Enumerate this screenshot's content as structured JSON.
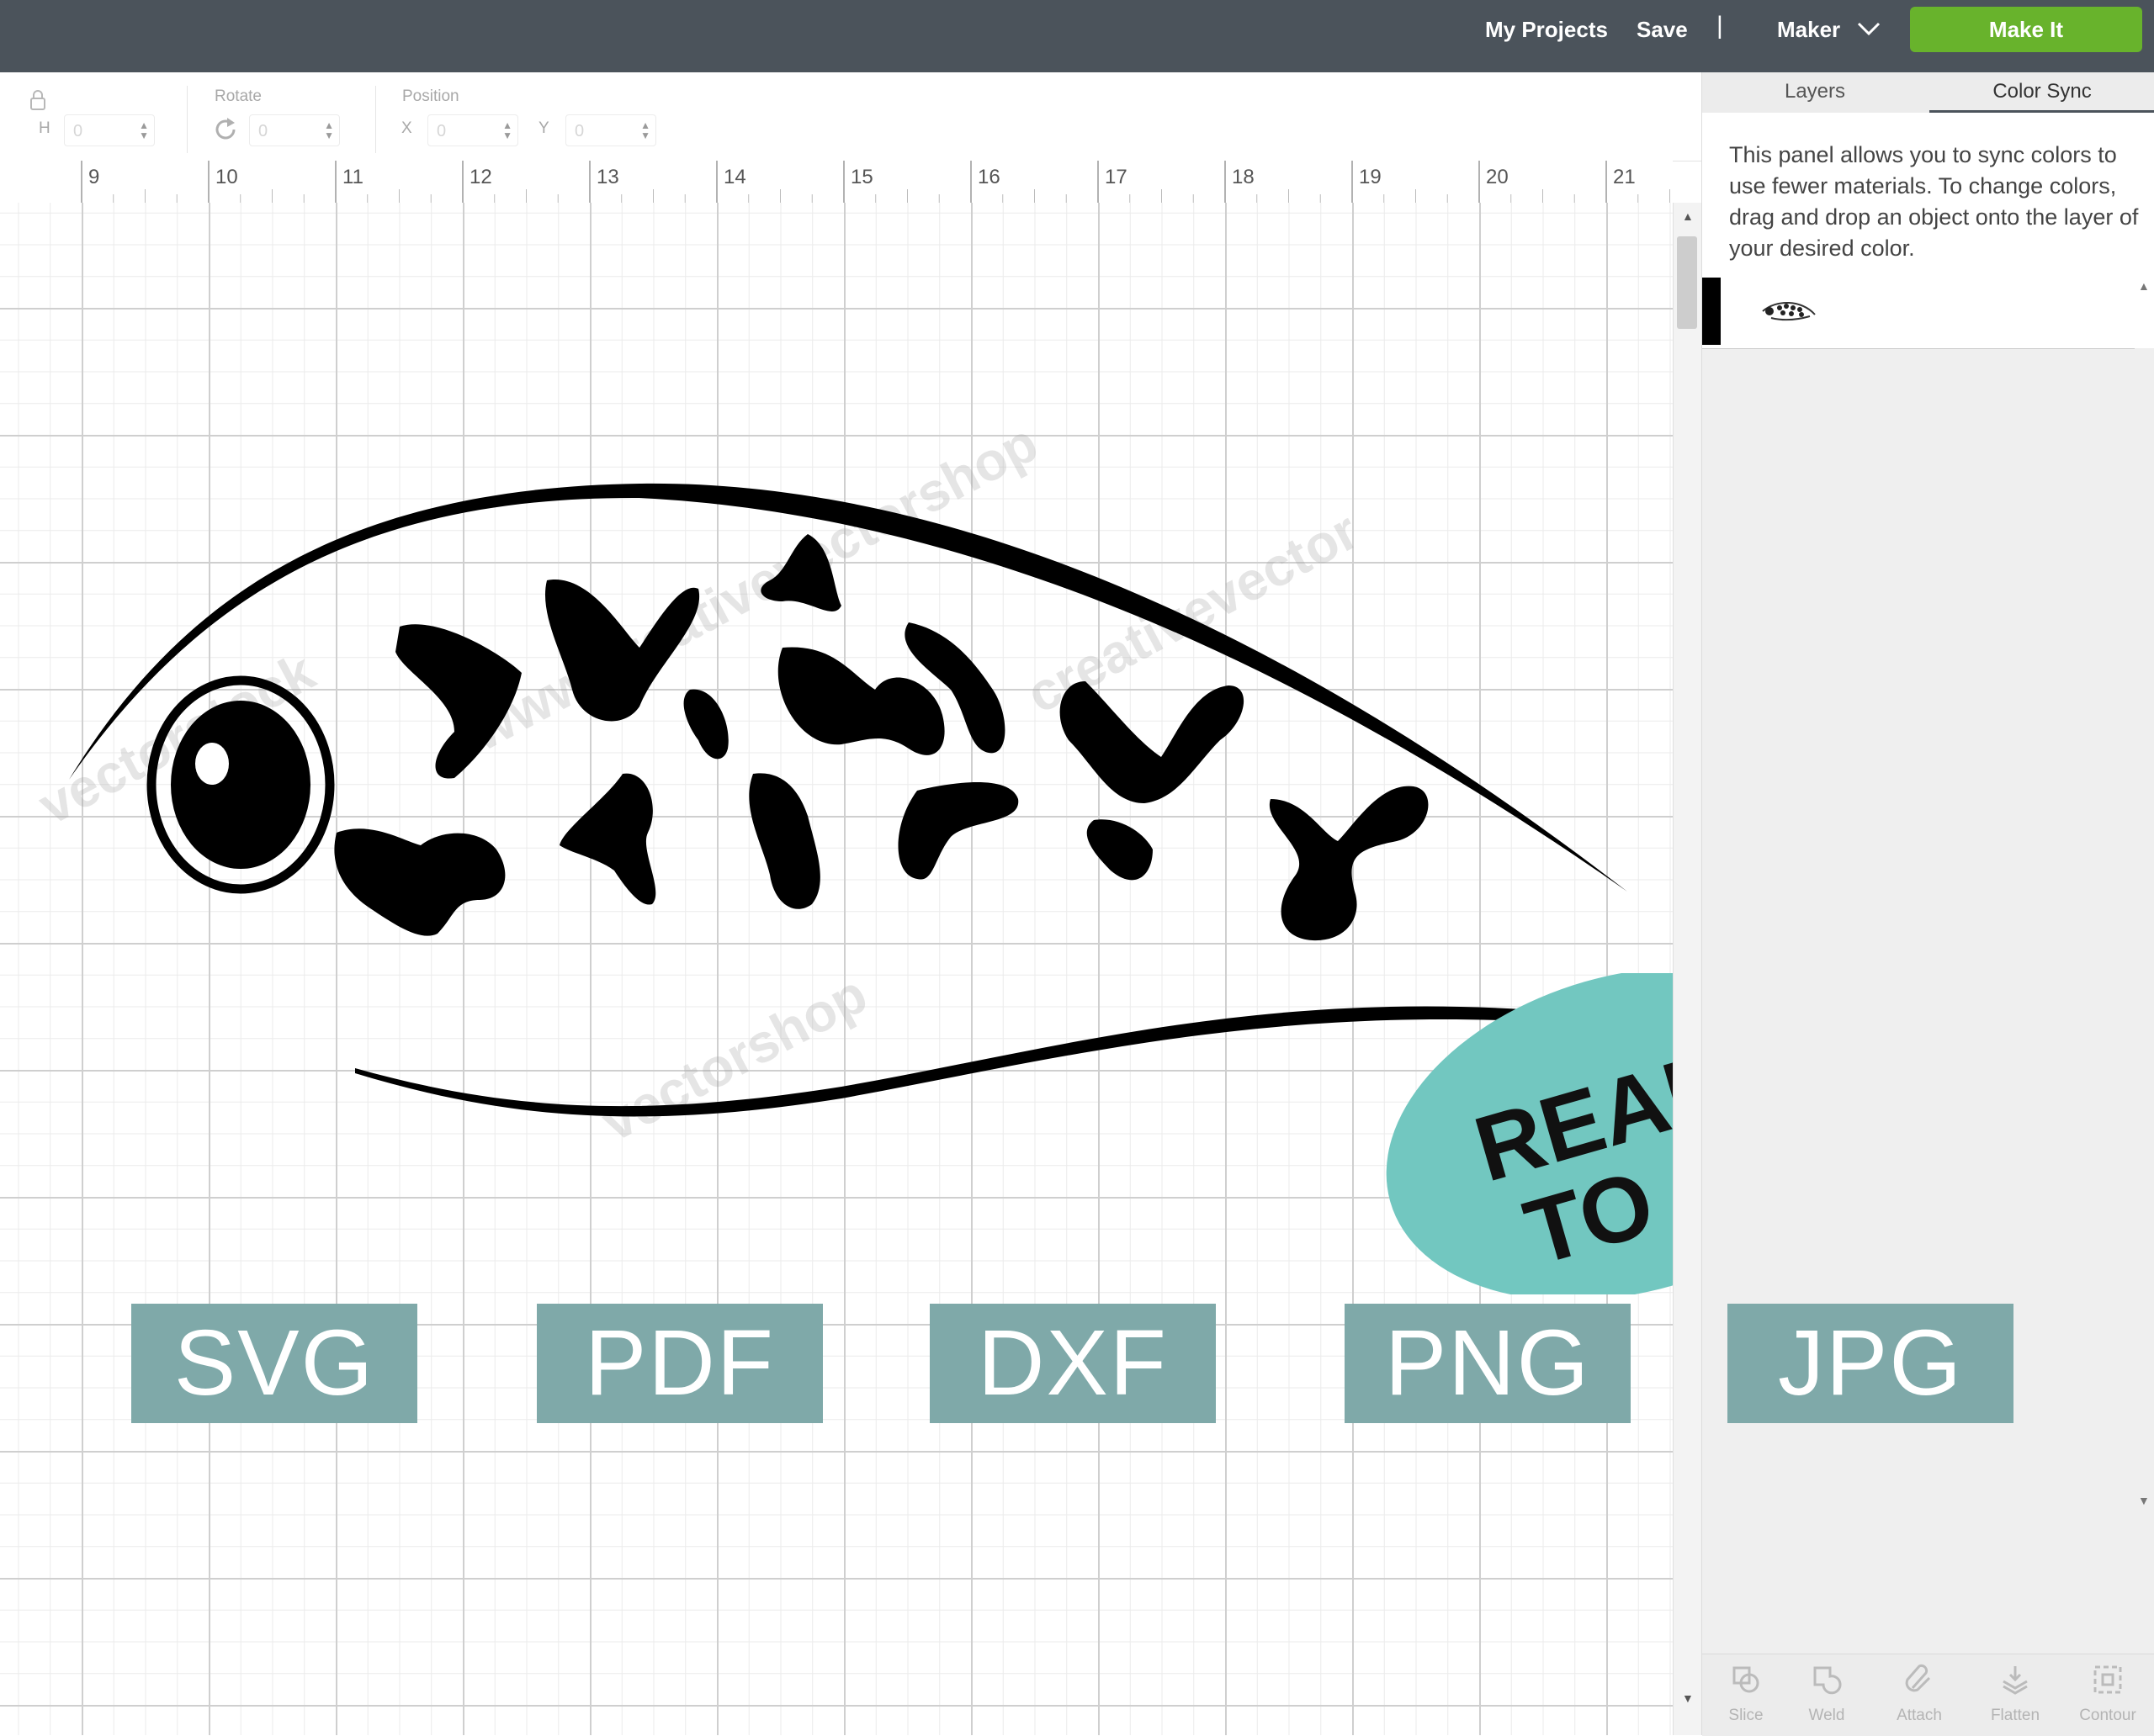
{
  "topbar": {
    "my_projects": "My Projects",
    "save": "Save",
    "divider": "|",
    "maker": "Maker",
    "make_it": "Make It",
    "icons": [
      "chevron-down-icon"
    ]
  },
  "toolbar": {
    "size_h_label": "H",
    "size_h_value": "0",
    "rotate_label": "Rotate",
    "rotate_value": "0",
    "position_label": "Position",
    "x_label": "X",
    "x_value": "0",
    "y_label": "Y",
    "y_value": "0",
    "icons": [
      "lock-icon",
      "rotate-icon"
    ]
  },
  "ruler": {
    "ticks": [
      "9",
      "10",
      "11",
      "12",
      "13",
      "14",
      "15",
      "16",
      "17",
      "18",
      "19",
      "20",
      "21"
    ]
  },
  "badge": {
    "line1": "READY",
    "line2": "TO CUT",
    "color": "#72c7c0"
  },
  "formats": [
    "SVG",
    "PDF",
    "DXF",
    "PNG",
    "JPG"
  ],
  "format_color": "#7fa9a9",
  "panel": {
    "tabs": [
      "Layers",
      "Color Sync"
    ],
    "active_tab": "Color Sync",
    "description": "This panel allows you to sync colors to use fewer materials. To change colors, drag and drop an object onto the layer of your desired color.",
    "layer_color": "#000000"
  },
  "bottom_tools": [
    "Slice",
    "Weld",
    "Attach",
    "Flatten",
    "Contour"
  ],
  "colors": {
    "topbar": "#4b535b",
    "make_it": "#68b32c"
  }
}
